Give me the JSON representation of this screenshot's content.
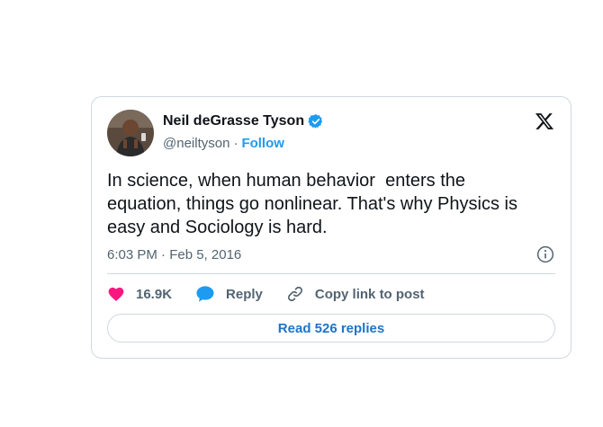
{
  "author": {
    "display_name": "Neil deGrasse Tyson",
    "handle": "@neiltyson",
    "separator": "·",
    "follow_label": "Follow",
    "verified_icon": "verified-badge-icon"
  },
  "tweet": {
    "text": "In science, when human behavior  enters the\nequation, things go nonlinear. That's why Physics is\neasy and Sociology is hard.",
    "timestamp": "6:03 PM · Feb 5, 2016"
  },
  "actions": {
    "like_count": "16.9K",
    "reply_label": "Reply",
    "copy_link_label": "Copy link to post"
  },
  "replies_button": {
    "label": "Read 526 replies"
  },
  "colors": {
    "accent": "#1d9bf0",
    "like": "#f91880",
    "reply_icon": "#1d9bf0",
    "text": "#0f1419",
    "muted": "#536471",
    "border": "#cfd9de"
  }
}
